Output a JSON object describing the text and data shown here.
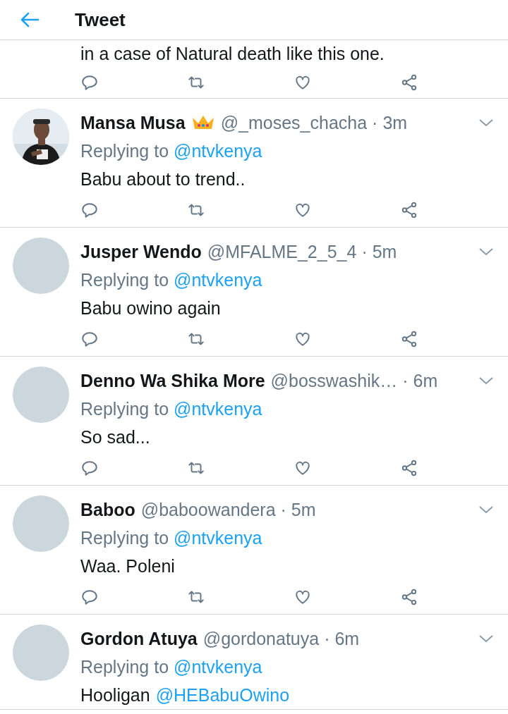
{
  "header": {
    "title": "Tweet"
  },
  "top_tweet": {
    "body": "in a case of Natural death like this one."
  },
  "replies": [
    {
      "kind": "photo_avatar",
      "name": "Mansa Musa",
      "crown_badge": true,
      "handle": "@_moses_chacha",
      "time": "· 3m",
      "replying_label": "Replying to",
      "replying_to": "@ntvkenya",
      "body": [
        {
          "kind": "text",
          "text": "Babu about to trend.."
        }
      ],
      "actions": true
    },
    {
      "kind": "plain_avatar",
      "name": "Jusper Wendo",
      "crown_badge": false,
      "handle": "@MFALME_2_5_4",
      "time": "· 5m",
      "replying_label": "Replying to",
      "replying_to": "@ntvkenya",
      "body": [
        {
          "kind": "text",
          "text": "Babu owino again"
        }
      ],
      "actions": true
    },
    {
      "kind": "plain_avatar",
      "name": "Denno Wa Shika More",
      "crown_badge": false,
      "handle": "@bosswashik…",
      "time": "· 6m",
      "replying_label": "Replying to",
      "replying_to": "@ntvkenya",
      "body": [
        {
          "kind": "text",
          "text": "So sad..."
        }
      ],
      "actions": true
    },
    {
      "kind": "plain_avatar",
      "name": "Baboo",
      "crown_badge": false,
      "handle": "@baboowandera",
      "time": "· 5m",
      "replying_label": "Replying to",
      "replying_to": "@ntvkenya",
      "body": [
        {
          "kind": "text",
          "text": "Waa. Poleni"
        }
      ],
      "actions": true
    },
    {
      "kind": "plain_avatar",
      "name": "Gordon Atuya",
      "crown_badge": false,
      "handle": "@gordonatuya",
      "time": "· 6m",
      "replying_label": "Replying to",
      "replying_to": "@ntvkenya",
      "body": [
        {
          "kind": "text",
          "text": "Hooligan"
        },
        {
          "kind": "mention",
          "text": "@HEBabuOwino"
        }
      ],
      "actions": false
    }
  ]
}
